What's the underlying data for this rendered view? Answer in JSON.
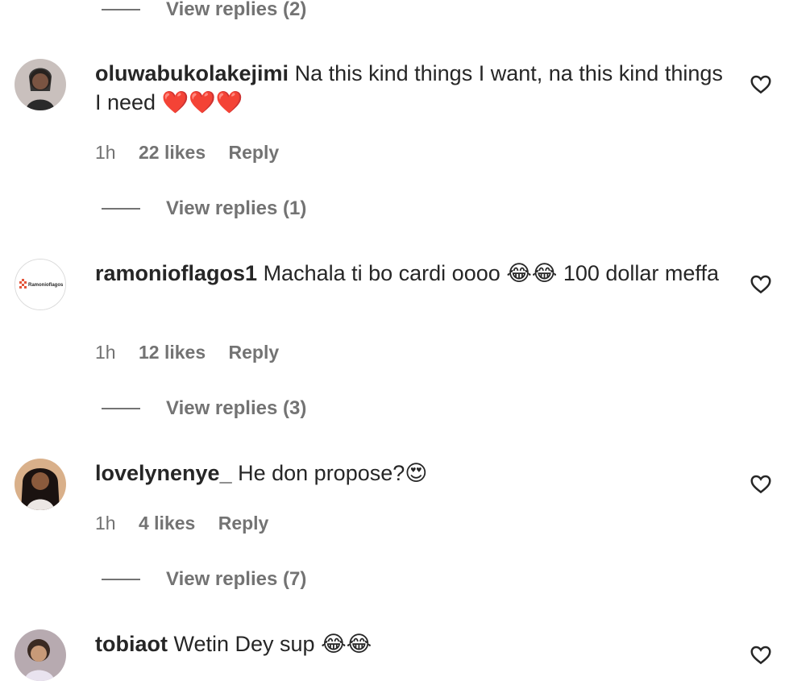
{
  "top_reply": {
    "label": "View replies (2)"
  },
  "comments": [
    {
      "username": "oluwabukolakejimi",
      "text": "Na this kind things I want, na this kind things I need ❤️❤️❤️",
      "time": "1h",
      "likes": "22 likes",
      "reply_label": "Reply",
      "view_replies": "View replies (1)"
    },
    {
      "username": "ramonioflagos1",
      "avatar_text": "Ramonioflagos",
      "text": "Machala ti bo cardi oooo 😂😂 100 dollar meffa",
      "time": "1h",
      "likes": "12 likes",
      "reply_label": "Reply",
      "view_replies": "View replies (3)"
    },
    {
      "username": "lovelynenye_",
      "text": "He don propose?😍",
      "time": "1h",
      "likes": "4 likes",
      "reply_label": "Reply",
      "view_replies": "View replies (7)"
    },
    {
      "username": "tobiaot",
      "text": "Wetin Dey sup 😂😂"
    }
  ],
  "colors": {
    "text": "#262626",
    "secondary": "#737373",
    "divider": "#737373"
  },
  "icons": {
    "like": "heart-outline-icon"
  }
}
